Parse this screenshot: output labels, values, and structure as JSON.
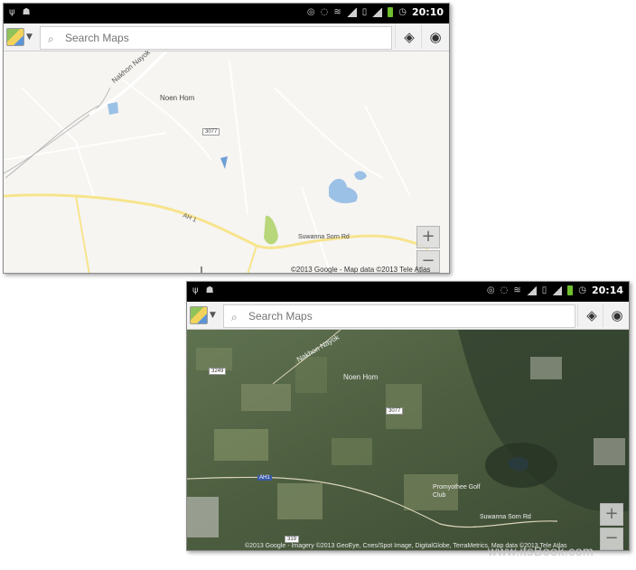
{
  "screens": [
    {
      "status": {
        "time": "20:10"
      },
      "search": {
        "placeholder": "Search Maps"
      },
      "map": {
        "mode": "map",
        "labels": {
          "nakhon_nayok": "Nakhon Nayok",
          "noen_hom": "Noen Hom",
          "route_3077": "3077",
          "route_ah1": "AH 1",
          "suwanna_sorn": "Suwanna Sorn Rd"
        },
        "copyright": "©2013 Google - Map data ©2013 Tele Atlas"
      }
    },
    {
      "status": {
        "time": "20:14"
      },
      "search": {
        "placeholder": "Search Maps"
      },
      "map": {
        "mode": "satellite",
        "labels": {
          "nakhon_nayok": "Nakhon Nayok",
          "noen_hom": "Noen Hom",
          "route_3077": "3077",
          "route_3249": "3249",
          "route_ah1": "AH1",
          "promyothee": "Promyothee Golf Club",
          "suwanna_sorn": "Suwanna Sorn Rd",
          "route_319": "319"
        },
        "copyright": "©2013 Google - Imagery ©2013 GeoEye, Cnes/Spot Image, DigitalGlobe, TerraMetrics, Map data ©2013 Tele Atlas"
      }
    }
  ],
  "icons": {
    "usb": "usb-icon",
    "android": "android-icon",
    "wifi": "wifi-icon",
    "battery": "battery-icon",
    "alarm": "alarm-icon",
    "layers": "layers-icon",
    "location": "my-location-icon",
    "search": "search-icon"
  },
  "zoom": {
    "in": "+",
    "out": "−"
  },
  "watermark": "www.itsBook.com",
  "colors": {
    "battery": "#6fbf2f",
    "road": "#f7e48c",
    "water": "#9cc1e6",
    "park": "#b7d77a"
  }
}
